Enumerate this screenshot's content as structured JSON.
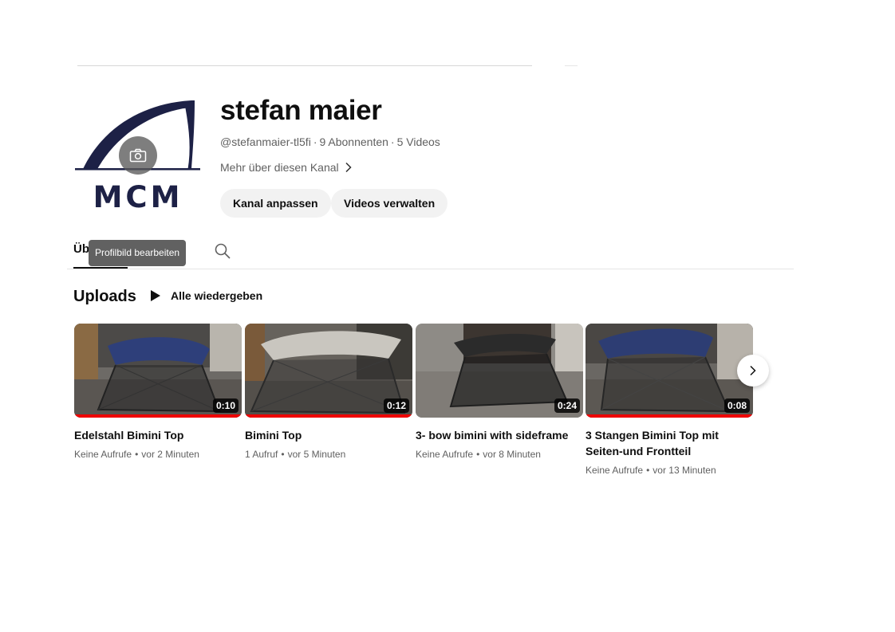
{
  "channel": {
    "name": "stefan maier",
    "handle": "@stefanmaier-tl5fi",
    "subscribers": "9 Abonnenten",
    "video_count": "5 Videos",
    "separator": "·",
    "more_link": "Mehr über diesen Kanal",
    "logo_text": "MCM",
    "customize_label": "Kanal anpassen",
    "manage_label": "Videos verwalten",
    "avatar_tooltip": "Profilbild bearbeiten",
    "camera_icon": "camera-icon"
  },
  "tabs": {
    "home_label": "Üb",
    "search_icon": "search-icon"
  },
  "uploads": {
    "title": "Uploads",
    "play_all_label": "Alle wiedergeben",
    "meta_separator": "•",
    "videos": [
      {
        "title": "Edelstahl Bimini Top",
        "duration": "0:10",
        "views": "Keine Aufrufe",
        "age": "vor 2 Minuten"
      },
      {
        "title": "Bimini Top",
        "duration": "0:12",
        "views": "1 Aufruf",
        "age": "vor 5 Minuten"
      },
      {
        "title": "3- bow bimini with sideframe",
        "duration": "0:24",
        "views": "Keine Aufrufe",
        "age": "vor 8 Minuten"
      },
      {
        "title": "3 Stangen Bimini Top mit Seiten-und Frontteil",
        "duration": "0:08",
        "views": "Keine Aufrufe",
        "age": "vor 13 Minuten"
      }
    ]
  },
  "colors": {
    "logo_navy": "#1d2146",
    "progress_red": "#ee0000",
    "button_bg": "#f2f2f2",
    "meta_text": "#606060"
  }
}
